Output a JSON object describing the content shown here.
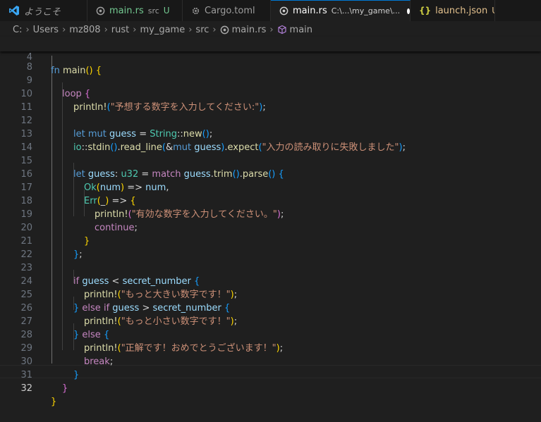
{
  "tabs": [
    {
      "name": "ようこそ",
      "description": "",
      "status": ""
    },
    {
      "name": "main.rs",
      "description": "src",
      "status": "U"
    },
    {
      "name": "Cargo.toml",
      "description": "",
      "status": ""
    },
    {
      "name": "main.rs",
      "description": "C:\\...\\my_game\\...",
      "status": "",
      "dirty": true
    },
    {
      "name": "launch.json",
      "description": "",
      "status": "U"
    }
  ],
  "breadcrumb": [
    "C:",
    "Users",
    "mz808",
    "rust",
    "my_game",
    "src",
    "main.rs",
    "main"
  ],
  "sticky_line": {
    "number": "4",
    "text": "fn main() {"
  },
  "partial_line_number": "8",
  "current_line": "32",
  "line_numbers": [
    "9",
    "10",
    "11",
    "12",
    "13",
    "14",
    "15",
    "16",
    "17",
    "18",
    "19",
    "20",
    "21",
    "22",
    "23",
    "24",
    "25",
    "26",
    "27",
    "28",
    "29",
    "30",
    "31",
    "32"
  ],
  "code": {
    "l9_kw": "loop",
    "l10_fn": "println!",
    "l10_str": "\"予想する数字を入力してください:\"",
    "l12_let": "let",
    "l12_mut": "mut",
    "l12_var": "guess",
    "l12_type": "String",
    "l12_fn": "new",
    "l13_mod": "io",
    "l13_stdin": "stdin",
    "l13_readline": "read_line",
    "l13_mut": "mut",
    "l13_var": "guess",
    "l13_expect": "expect",
    "l13_str": "\"入力の読み取りに失敗しました\"",
    "l15_let": "let",
    "l15_var": "guess",
    "l15_type": "u32",
    "l15_match": "match",
    "l15_guess": "guess",
    "l15_trim": "trim",
    "l15_parse": "parse",
    "l16_ok": "Ok",
    "l16_num": "num",
    "l16_num2": "num",
    "l17_err": "Err",
    "l18_fn": "println!",
    "l18_str": "\"有効な数字を入力してください。\"",
    "l19_kw": "continue",
    "l23_if": "if",
    "l23_guess": "guess",
    "l23_secret": "secret_number",
    "l24_fn": "println!",
    "l24_str": "\"もっと大きい数字です！\"",
    "l25_else": "else",
    "l25_if": "if",
    "l25_guess": "guess",
    "l25_secret": "secret_number",
    "l26_fn": "println!",
    "l26_str": "\"もっと小さい数字です！\"",
    "l27_else": "else",
    "l28_fn": "println!",
    "l28_str": "\"正解です！おめでとうございます！\"",
    "l29_kw": "break",
    "sticky_fn": "fn",
    "sticky_name": "main"
  },
  "colors": {
    "accent": "#0078d4",
    "keyword": "#569cd6",
    "control": "#c586c0",
    "function": "#dcdcaa",
    "string": "#ce9178",
    "variable": "#9cdcfe",
    "type": "#4ec9b0"
  },
  "icons": {
    "app": "vscode-logo-icon",
    "rust_file": "rust-file-icon",
    "toml_file": "gear-icon",
    "json_file": "braces-icon",
    "symbol": "cube-symbol-icon"
  }
}
